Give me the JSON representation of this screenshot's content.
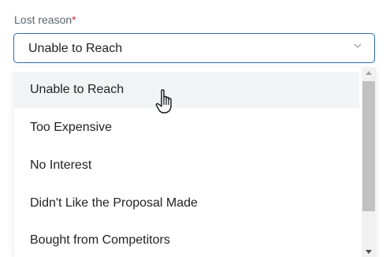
{
  "field": {
    "label": "Lost reason",
    "required_mark": "*",
    "selected_value": "Unable to Reach"
  },
  "dropdown": {
    "options": [
      {
        "label": "Unable to Reach",
        "hovered": true
      },
      {
        "label": "Too Expensive",
        "hovered": false
      },
      {
        "label": "No Interest",
        "hovered": false
      },
      {
        "label": "Didn't Like the Proposal Made",
        "hovered": false
      },
      {
        "label": "Bought from Competitors",
        "hovered": false
      }
    ]
  },
  "icons": {
    "chevron": "chevron-down-icon",
    "cursor": "hand-pointer-cursor-icon"
  },
  "colors": {
    "focus_border": "#2b6cb0",
    "required": "#e0283a",
    "hover_bg": "#f2f3f5"
  }
}
